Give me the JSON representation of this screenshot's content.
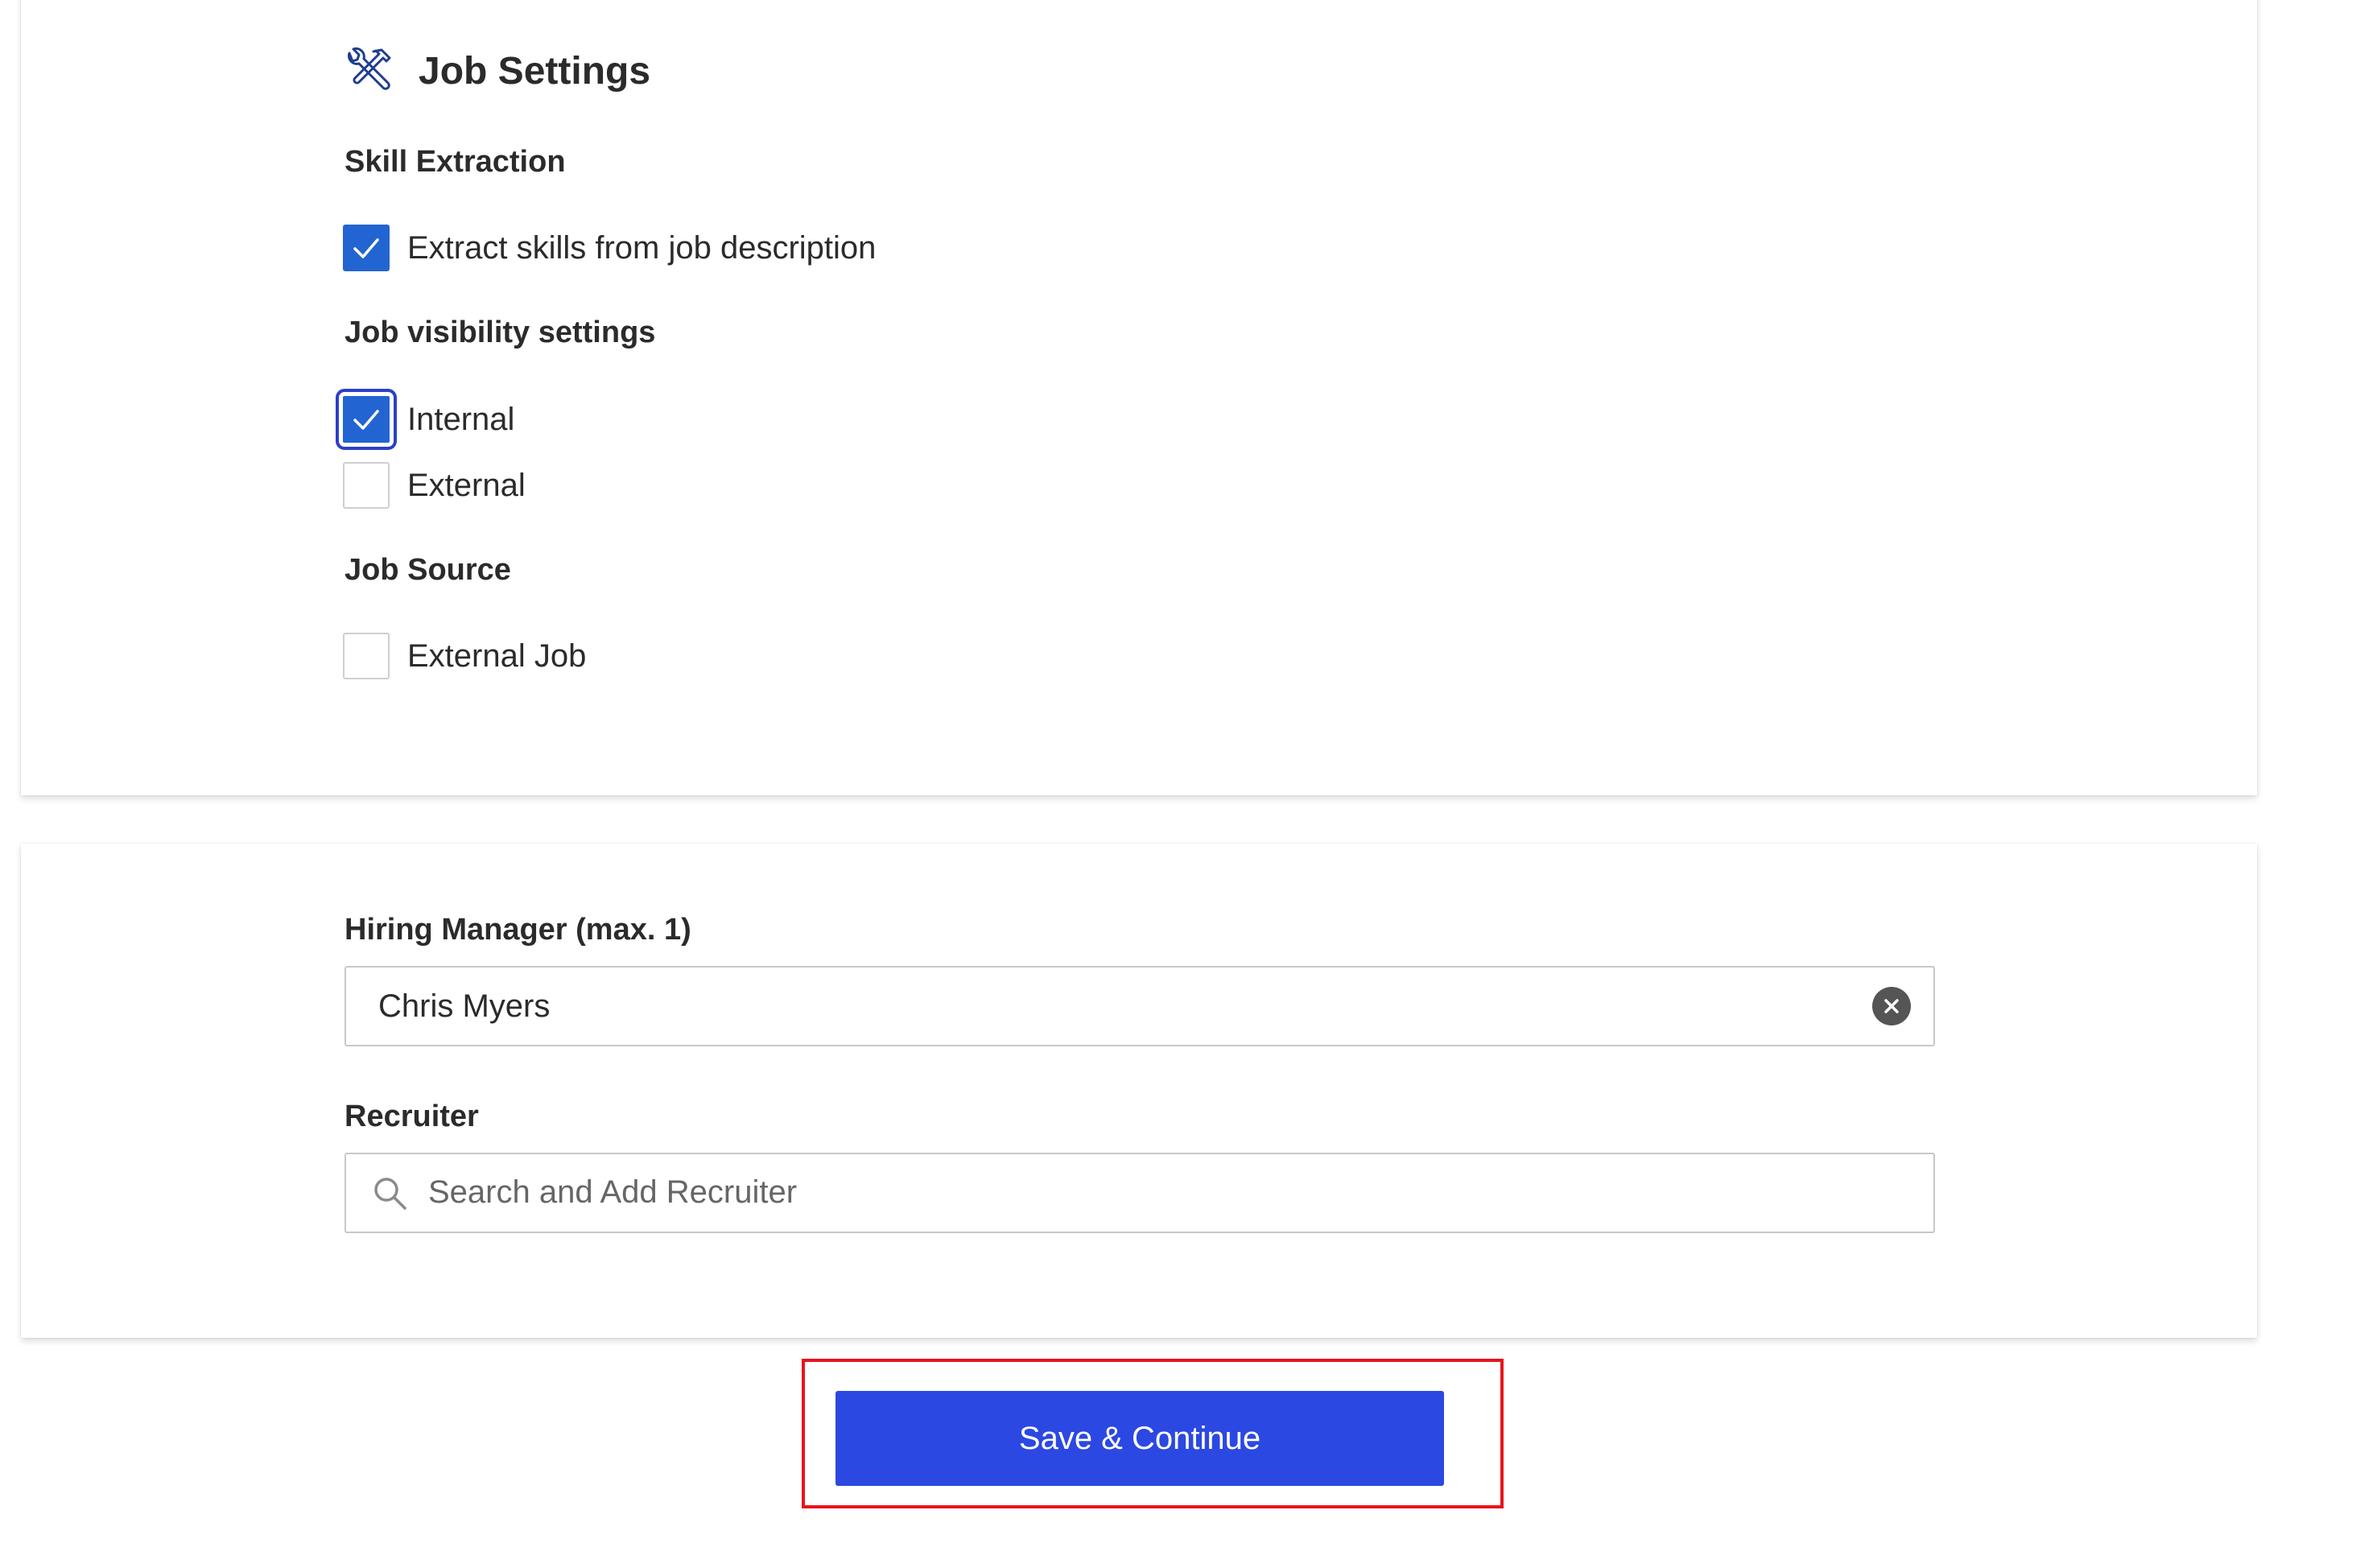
{
  "job_settings": {
    "title": "Job Settings",
    "title_icon": "tools-icon",
    "skill_extraction": {
      "label": "Skill Extraction",
      "options": [
        {
          "label": "Extract skills from job description",
          "checked": true
        }
      ]
    },
    "visibility": {
      "label": "Job visibility settings",
      "options": [
        {
          "label": "Internal",
          "checked": true,
          "focused": true
        },
        {
          "label": "External",
          "checked": false
        }
      ]
    },
    "job_source": {
      "label": "Job Source",
      "options": [
        {
          "label": "External Job",
          "checked": false
        }
      ]
    }
  },
  "people": {
    "hiring_manager": {
      "label": "Hiring Manager (max. 1)",
      "value": "Chris Myers"
    },
    "recruiter": {
      "label": "Recruiter",
      "placeholder": "Search and Add Recruiter",
      "value": ""
    }
  },
  "actions": {
    "save_continue_label": "Save & Continue"
  },
  "colors": {
    "checkbox_checked": "#2264d1",
    "focus_ring": "#2a40c9",
    "primary_button": "#2b48e2",
    "highlight": "#e8141b",
    "icon_blue": "#1f3d8f"
  }
}
